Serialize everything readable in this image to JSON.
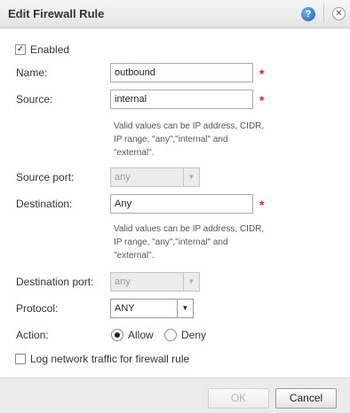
{
  "dialog": {
    "title": "Edit Firewall Rule",
    "help_icon": "?",
    "close_icon": "✕"
  },
  "enabled": {
    "label": "Enabled",
    "checked": true
  },
  "name": {
    "label": "Name:",
    "value": "outbound"
  },
  "source": {
    "label": "Source:",
    "value": "internal",
    "help": "Valid values can be IP address, CIDR, IP range, \"any\",\"internal\" and \"external\"."
  },
  "source_port": {
    "label": "Source port:",
    "value": "any"
  },
  "destination": {
    "label": "Destination:",
    "value": "Any",
    "help": "Valid values can be IP address, CIDR, IP range, \"any\",\"internal\" and \"external\"."
  },
  "destination_port": {
    "label": "Destination port:",
    "value": "any"
  },
  "protocol": {
    "label": "Protocol:",
    "value": "ANY"
  },
  "action": {
    "label": "Action:",
    "options": [
      "Allow",
      "Deny"
    ],
    "selected": "Allow"
  },
  "log": {
    "label": "Log network traffic for firewall rule",
    "checked": false
  },
  "buttons": {
    "ok": "OK",
    "cancel": "Cancel"
  },
  "required_marker": "*",
  "dropdown_arrow": "▼"
}
